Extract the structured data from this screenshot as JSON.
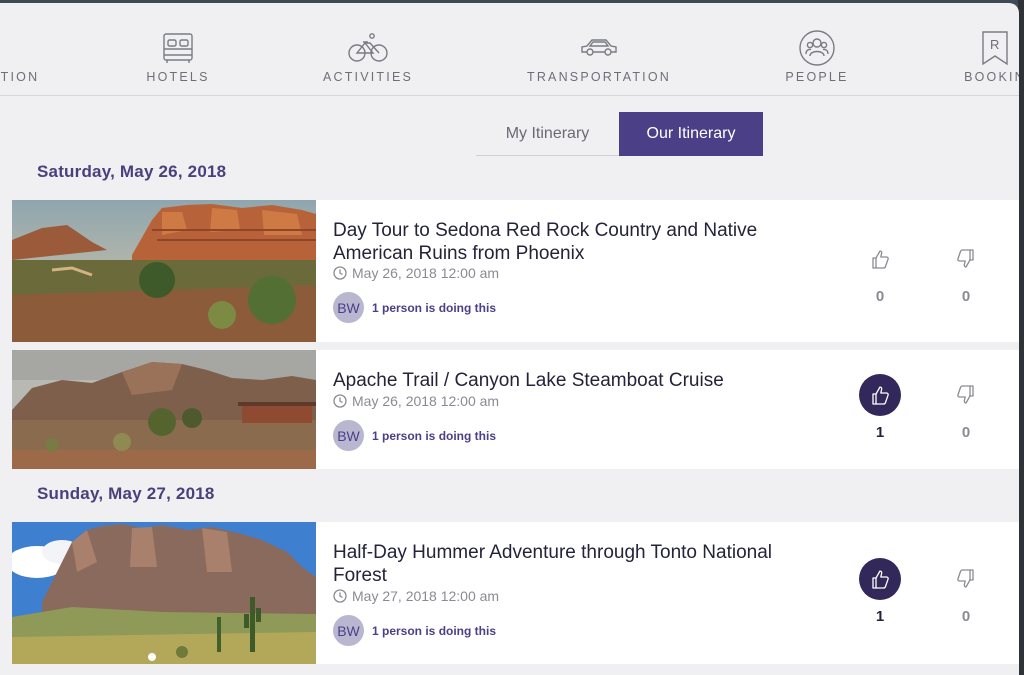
{
  "nav": {
    "items": [
      {
        "label": "TION",
        "icon": "star-icon"
      },
      {
        "label": "HOTELS",
        "icon": "bed-icon"
      },
      {
        "label": "ACTIVITIES",
        "icon": "bicycle-icon"
      },
      {
        "label": "TRANSPORTATION",
        "icon": "car-icon"
      },
      {
        "label": "PEOPLE",
        "icon": "people-icon"
      },
      {
        "label": "BOOKIN",
        "icon": "bookmark-icon"
      }
    ],
    "bookmark_letter": "R"
  },
  "tabs": {
    "my_itinerary": "My Itinerary",
    "our_itinerary": "Our Itinerary",
    "active": "Our Itinerary"
  },
  "days": [
    {
      "date": "Saturday, May 26, 2018",
      "activities": [
        {
          "title": "Day Tour to Sedona Red Rock Country and Native American Ruins from Phoenix",
          "datetime": "May 26, 2018 12:00 am",
          "avatar_initials": "BW",
          "people_text": "1 person is doing this",
          "likes": "0",
          "dislikes": "0",
          "liked": false
        },
        {
          "title": "Apache Trail / Canyon Lake Steamboat Cruise",
          "datetime": "May 26, 2018 12:00 am",
          "avatar_initials": "BW",
          "people_text": "1 person is doing this",
          "likes": "1",
          "dislikes": "0",
          "liked": true
        }
      ]
    },
    {
      "date": "Sunday, May 27, 2018",
      "activities": [
        {
          "title": "Half-Day Hummer Adventure through Tonto National Forest",
          "datetime": "May 27, 2018 12:00 am",
          "avatar_initials": "BW",
          "people_text": "1 person is doing this",
          "likes": "1",
          "dislikes": "0",
          "liked": true
        }
      ]
    }
  ],
  "colors": {
    "accent": "#4b3f87",
    "liked_fill": "#33285a",
    "date_heading": "#4b3f7c"
  }
}
